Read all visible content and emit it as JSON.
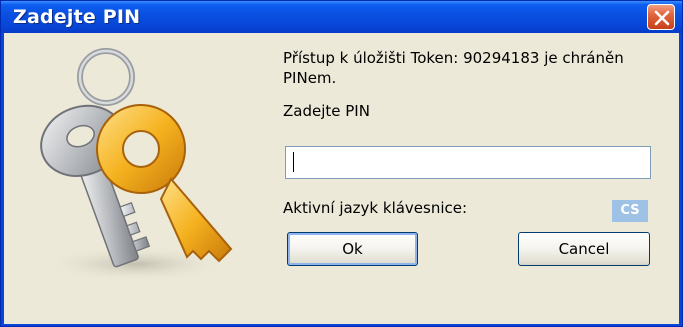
{
  "window": {
    "title": "Zadejte PIN",
    "close_icon": "close-icon"
  },
  "dialog": {
    "icon": "keys-icon",
    "message": "Přístup k úložišti Token: 90294183 je chráněn PINem.",
    "pin_label": "Zadejte PIN",
    "pin_value": "",
    "keyboard_language_label": "Aktivní jazyk klávesnice:",
    "keyboard_language": "CS"
  },
  "buttons": {
    "ok_label": "Ok",
    "cancel_label": "Cancel"
  },
  "colors": {
    "titlebar": "#0a51e2",
    "close_button": "#e0653e",
    "dialog_background": "#ece9d8",
    "language_badge": "#9ec1e6"
  }
}
